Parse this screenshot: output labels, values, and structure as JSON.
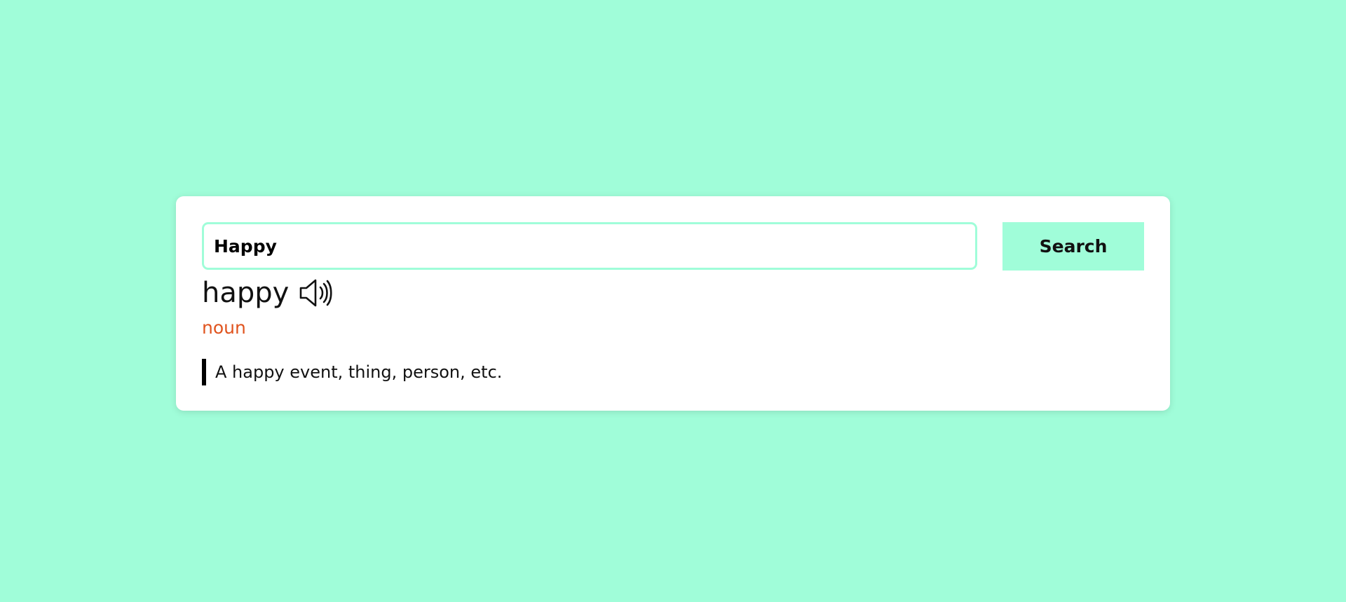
{
  "colors": {
    "background": "#a0fdd9",
    "card": "#ffffff",
    "accent": "#a0fdd9",
    "part_of_speech": "#e0541f"
  },
  "search": {
    "value": "Happy",
    "button_label": "Search"
  },
  "result": {
    "word": "happy",
    "audio_icon": "speaker-icon",
    "part_of_speech": "noun",
    "definition": "A happy event, thing, person, etc."
  }
}
